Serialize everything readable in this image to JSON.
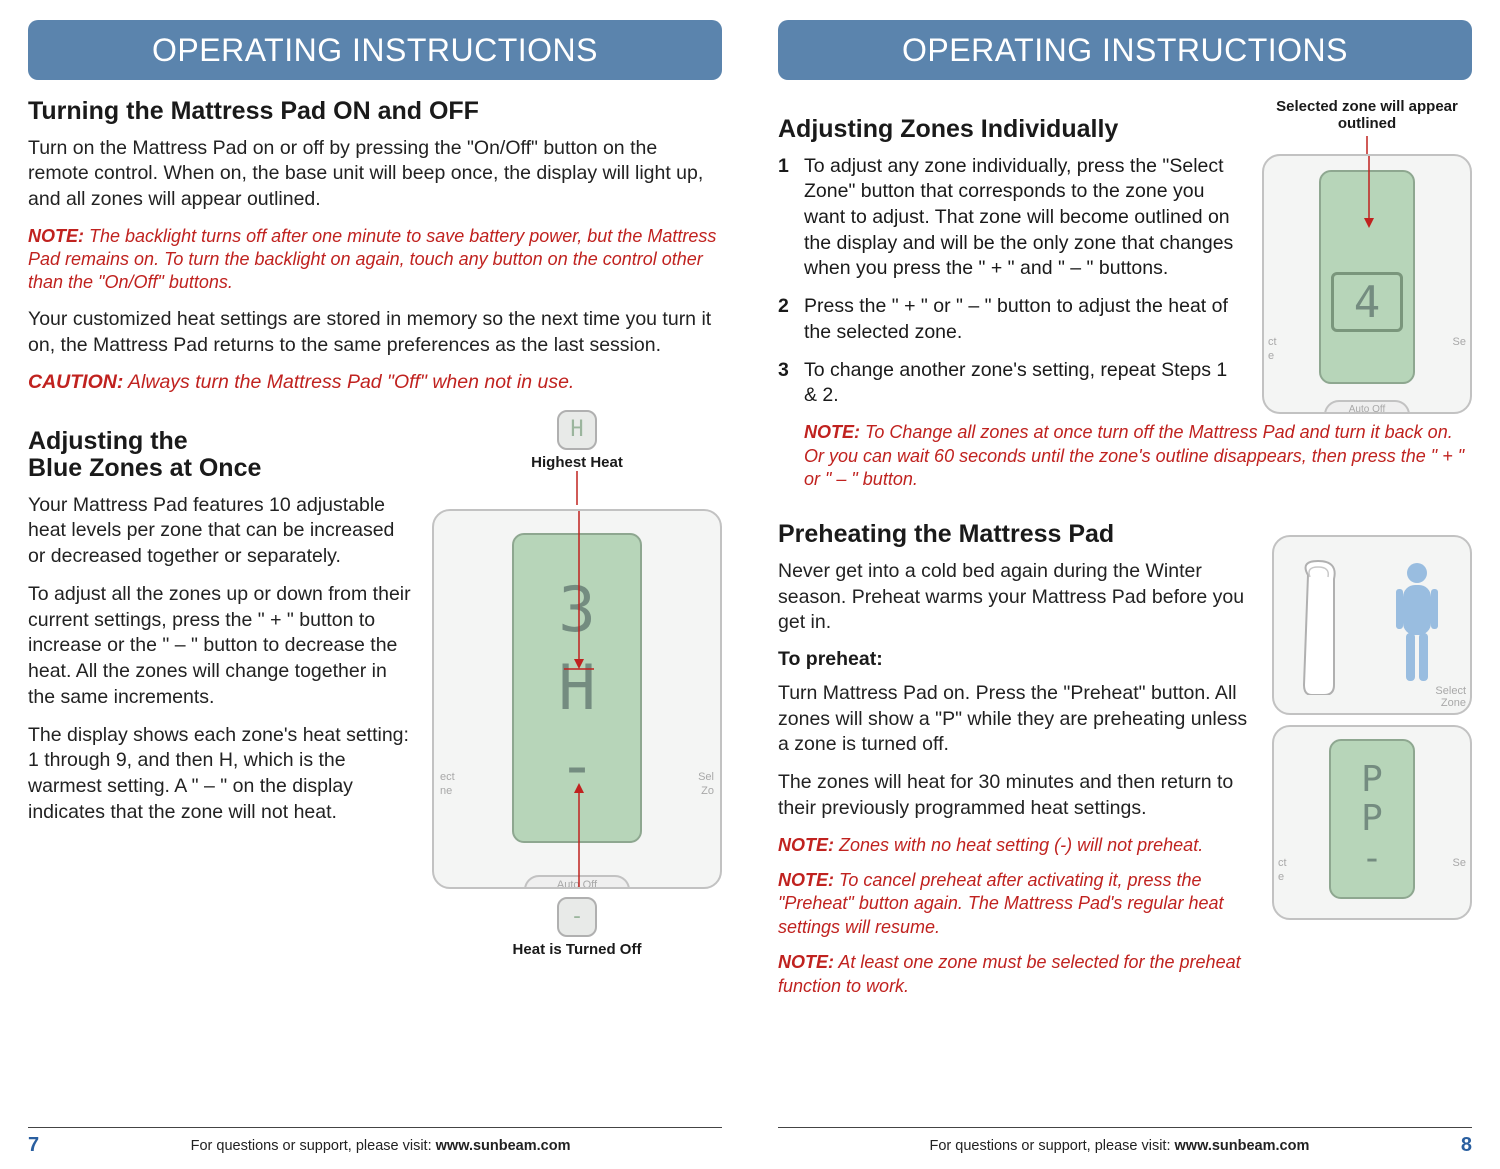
{
  "header": {
    "title": "OPERATING INSTRUCTIONS"
  },
  "page_left": {
    "section1_title": "Turning the Mattress Pad ON and OFF",
    "p1": "Turn on the Mattress Pad on or off by pressing the \"On/Off\" button on the remote control. When on, the base unit will beep once, the display will light up, and all zones will appear outlined.",
    "note1_label": "NOTE:",
    "note1": "The backlight turns off after one minute to save battery power, but the Mattress Pad remains on. To turn the backlight on again, touch any button on the control other than the \"On/Off\" buttons.",
    "p2": "Your customized heat settings are stored in memory so the next time you turn it on, the Mattress Pad returns to the same preferences as the last session.",
    "caution_label": "CAUTION:",
    "caution": "Always turn the Mattress Pad \"Off\" when not in use.",
    "section2_title": "Adjusting the\nBlue Zones at Once",
    "p3": "Your Mattress Pad features 10 adjustable heat levels per zone that can be increased or decreased together or separately.",
    "p4": "To adjust all the zones up or down from their current settings, press the \" + \" button to increase or the \" – \" button to decrease the heat. All the zones will change together in the same increments.",
    "p5": "The display shows each zone's heat setting: 1 through 9, and then H, which is the warmest setting. A \" – \" on the display indicates that the zone will not heat.",
    "fig_caption_top": "Highest Heat",
    "fig_caption_bot": "Heat is Turned Off",
    "lcd_vals": [
      "3",
      "H",
      "-"
    ],
    "pill_top": "H",
    "pill_bot": "-",
    "page_num": "7"
  },
  "page_right": {
    "section1_title": "Adjusting Zones Individually",
    "fig1_caption": "Selected zone will appear outlined",
    "step1": "To adjust any zone individually, press the \"Select Zone\" button that corresponds to the zone you want to adjust. That zone will become outlined on the display and will be the only zone that changes when you press the \" + \" and \" – \" buttons.",
    "step2": "Press the \" + \" or \" – \" button to adjust the heat of the selected zone.",
    "step3": "To change another zone's setting, repeat Steps 1 & 2.",
    "note1_label": "NOTE:",
    "note1": "To Change all zones at once turn off the Mattress Pad and turn it back on. Or you can wait 60 seconds until the zone's outline disappears, then press the \" + \" or \" – \" button.",
    "section2_title": "Preheating the Mattress Pad",
    "p1": "Never get into a cold bed again during the Winter season. Preheat warms your Mattress Pad before you get in.",
    "subhead": "To preheat:",
    "p2": "Turn Mattress Pad on. Press the \"Preheat\" button. All zones will show a \"P\" while they are preheating unless a zone is turned off.",
    "p3": "The zones will heat for 30 minutes and then return to their previously programmed heat settings.",
    "note2_label": "NOTE:",
    "note2": "Zones with no heat setting (-) will not preheat.",
    "note3_label": "NOTE:",
    "note3": "To cancel preheat after activating it, press the \"Preheat\" button again. The Mattress Pad's regular heat settings will resume.",
    "note4_label": "NOTE:",
    "note4": "At least one zone must be selected for the preheat function to work.",
    "lcd_selected": "4",
    "lcd_preheat": [
      "P",
      "P",
      "-"
    ],
    "page_num": "8"
  },
  "footer": {
    "support_pre": "For questions or support, please visit: ",
    "url": "www.sunbeam.com"
  },
  "labels": {
    "select_zone_l": "ect",
    "select_zone_l2": "ne",
    "select_zone_r": "Sel",
    "select_zone_r2": "Zo",
    "auto_off": "Auto Off",
    "side_ct": "ct",
    "side_e": "e",
    "side_se": "Se"
  }
}
